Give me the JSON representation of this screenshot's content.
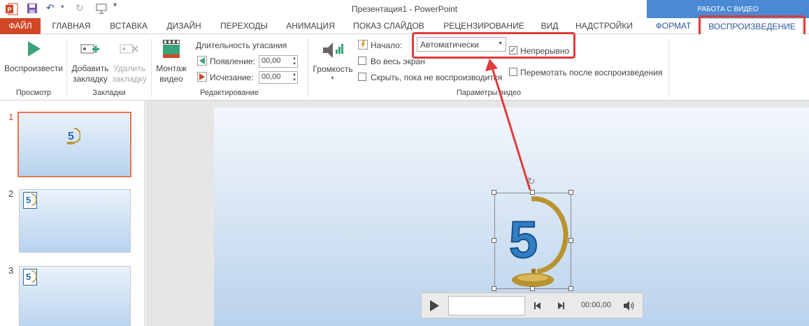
{
  "window": {
    "title": "Презентация1 - PowerPoint",
    "context_group": "РАБОТА С ВИДЕО"
  },
  "tabs": [
    "ФАЙЛ",
    "ГЛАВНАЯ",
    "ВСТАВКА",
    "ДИЗАЙН",
    "ПЕРЕХОДЫ",
    "АНИМАЦИЯ",
    "ПОКАЗ СЛАЙДОВ",
    "РЕЦЕНЗИРОВАНИЕ",
    "ВИД",
    "НАДСТРОЙКИ",
    "ФОРМАТ",
    "ВОСПРОИЗВЕДЕНИЕ"
  ],
  "ribbon": {
    "preview": {
      "play_label": "Воспроизвести",
      "group": "Просмотр"
    },
    "bookmarks": {
      "add_label_1": "Добавить",
      "add_label_2": "закладку",
      "remove_label_1": "Удалить",
      "remove_label_2": "закладку",
      "group": "Закладки"
    },
    "editing": {
      "trim_label_1": "Монтаж",
      "trim_label_2": "видео",
      "fade_title": "Длительность угасания",
      "fade_in_label": "Появление:",
      "fade_in_value": "00,00",
      "fade_out_label": "Исчезание:",
      "fade_out_value": "00,00",
      "group": "Редактирование"
    },
    "video_options": {
      "volume_label": "Громкость",
      "start_label": "Начало:",
      "start_value": "Автоматически",
      "loop_label": "Непрерывно",
      "loop_checked": true,
      "fullscreen_label": "Во весь экран",
      "hide_label": "Скрыть, пока не воспроизводится",
      "rewind_label": "Перемотать после воспроизведения",
      "group": "Параметры видео"
    }
  },
  "slides": [
    "1",
    "2",
    "3"
  ],
  "media": {
    "time": "00:00,00"
  },
  "colors": {
    "accent": "#d24726",
    "context": "#4a8ad4",
    "highlight": "#e03a3a"
  }
}
